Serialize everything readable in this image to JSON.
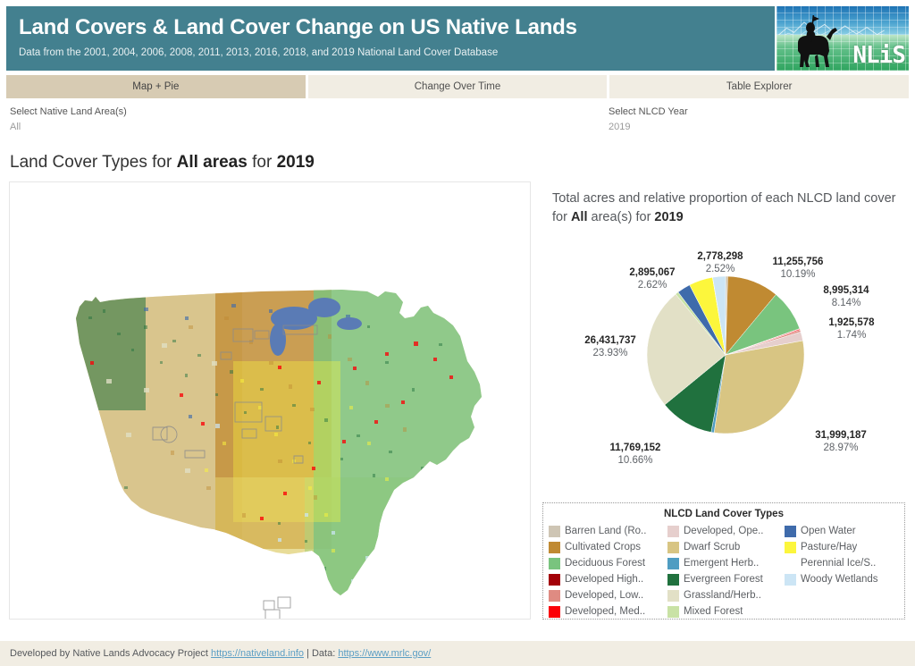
{
  "header": {
    "title": "Land Covers & Land Cover Change on US Native Lands",
    "subtitle": "Data from the 2001, 2004, 2006, 2008, 2011, 2013, 2016, 2018, and 2019 National Land Cover Database",
    "logo_text": "NLiS",
    "banner_color": "#43808f"
  },
  "tabs": [
    {
      "label": "Map + Pie",
      "active": true
    },
    {
      "label": "Change Over Time",
      "active": false
    },
    {
      "label": "Table Explorer",
      "active": false
    }
  ],
  "filters": {
    "area": {
      "label": "Select Native Land Area(s)",
      "value": "All"
    },
    "year": {
      "label": "Select NLCD Year",
      "value": "2019"
    }
  },
  "main_title": {
    "prefix": "Land Cover Types for ",
    "area": "All areas",
    "middle": " for ",
    "year": "2019"
  },
  "pie_caption": {
    "line1_prefix": "Total acres and relative proportion of each NLCD land cover",
    "line2_prefix": "for ",
    "area": "All",
    "line2_middle": " area(s) for ",
    "year": "2019"
  },
  "legend": {
    "title": "NLCD Land Cover Types",
    "columns": [
      [
        {
          "label": "Barren Land (Ro..",
          "color": "#cec5b4"
        },
        {
          "label": "Cultivated Crops",
          "color": "#c08a32"
        },
        {
          "label": "Deciduous Forest",
          "color": "#79c47e"
        },
        {
          "label": "Developed High..",
          "color": "#a30108"
        },
        {
          "label": "Developed, Low..",
          "color": "#df8b82"
        },
        {
          "label": "Developed, Med..",
          "color": "#fb0007"
        }
      ],
      [
        {
          "label": "Developed, Ope..",
          "color": "#e6cfcd"
        },
        {
          "label": "Dwarf Scrub",
          "color": "#d8c583"
        },
        {
          "label": "Emergent Herb..",
          "color": "#4f9dc2"
        },
        {
          "label": "Evergreen Forest",
          "color": "#20713e"
        },
        {
          "label": "Grassland/Herb..",
          "color": "#e2e0c6"
        },
        {
          "label": "Mixed Forest",
          "color": "#c9e2a5"
        }
      ],
      [
        {
          "label": "Open Water",
          "color": "#3f6bab"
        },
        {
          "label": "Pasture/Hay",
          "color": "#fcf63c"
        },
        {
          "label": "Perennial Ice/S..",
          "color": "#ffffff"
        },
        {
          "label": "Woody Wetlands",
          "color": "#cce5f5"
        }
      ]
    ]
  },
  "footer": {
    "prefix": "Developed by Native Lands Advocacy Project ",
    "link1": "https://nativeland.info",
    "middle": " | Data: ",
    "link2": "https://www.mrlc.gov/"
  },
  "chart_data": {
    "type": "pie",
    "title": "Total acres and relative proportion of each NLCD land cover for All area(s) for 2019",
    "units": "acres",
    "legend_position": "bottom",
    "labeled_slices": [
      {
        "value": "11,255,756",
        "percent": "10.19%"
      },
      {
        "value": "8,995,314",
        "percent": "8.14%"
      },
      {
        "value": "1,925,578",
        "percent": "1.74%"
      },
      {
        "value": "31,999,187",
        "percent": "28.97%"
      },
      {
        "value": "11,769,152",
        "percent": "10.66%"
      },
      {
        "value": "26,431,737",
        "percent": "23.93%"
      },
      {
        "value": "2,895,067",
        "percent": "2.62%"
      },
      {
        "value": "2,778,298",
        "percent": "2.52%"
      }
    ],
    "slices": [
      {
        "name": "Barren Land (Ro..",
        "value": 459000,
        "percent": 0.42,
        "color": "#cec5b4"
      },
      {
        "name": "Cultivated Crops",
        "value": 11255756,
        "percent": 10.19,
        "color": "#c08a32"
      },
      {
        "name": "Deciduous Forest",
        "value": 8995314,
        "percent": 8.14,
        "color": "#79c47e"
      },
      {
        "name": "Developed High..",
        "value": 120000,
        "percent": 0.11,
        "color": "#a30108"
      },
      {
        "name": "Developed, Med..",
        "value": 210000,
        "percent": 0.19,
        "color": "#fb0007"
      },
      {
        "name": "Developed, Low..",
        "value": 420000,
        "percent": 0.38,
        "color": "#df8b82"
      },
      {
        "name": "Developed, Ope..",
        "value": 1925578,
        "percent": 1.74,
        "color": "#e6cfcd"
      },
      {
        "name": "Dwarf Scrub",
        "value": 31999187,
        "percent": 28.97,
        "color": "#d8c583"
      },
      {
        "name": "Emergent Herb..",
        "value": 640000,
        "percent": 0.58,
        "color": "#4f9dc2"
      },
      {
        "name": "Evergreen Forest",
        "value": 11769152,
        "percent": 10.66,
        "color": "#20713e"
      },
      {
        "name": "Grassland/Herb..",
        "value": 26431737,
        "percent": 23.93,
        "color": "#e2e0c6"
      },
      {
        "name": "Mixed Forest",
        "value": 690000,
        "percent": 0.62,
        "color": "#c9e2a5"
      },
      {
        "name": "Open Water",
        "value": 2895067,
        "percent": 2.62,
        "color": "#3f6bab"
      },
      {
        "name": "Pasture/Hay",
        "value": 5200000,
        "percent": 4.71,
        "color": "#fcf63c"
      },
      {
        "name": "Perennial Ice/S..",
        "value": 25000,
        "percent": 0.02,
        "color": "#ffffff"
      },
      {
        "name": "Woody Wetlands",
        "value": 2778298,
        "percent": 2.52,
        "color": "#cce5f5"
      }
    ]
  }
}
